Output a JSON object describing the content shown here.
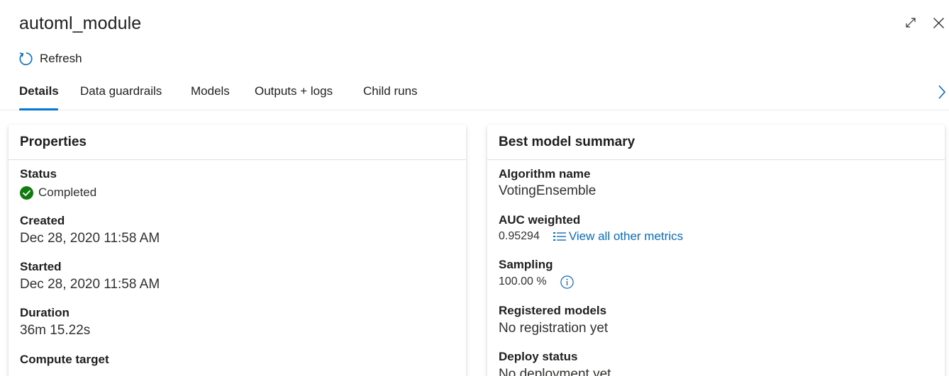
{
  "header": {
    "title": "automl_module",
    "refresh_label": "Refresh",
    "icons": {
      "expand": "expand-icon",
      "close": "close-icon",
      "refresh": "refresh-icon"
    }
  },
  "tabs": [
    {
      "label": "Details",
      "active": true
    },
    {
      "label": "Data guardrails",
      "active": false
    },
    {
      "label": "Models",
      "active": false
    },
    {
      "label": "Outputs + logs",
      "active": false
    },
    {
      "label": "Child runs",
      "active": false
    }
  ],
  "properties": {
    "heading": "Properties",
    "status_label": "Status",
    "status_value": "Completed",
    "created_label": "Created",
    "created_value": "Dec 28, 2020 11:58 AM",
    "started_label": "Started",
    "started_value": "Dec 28, 2020 11:58 AM",
    "duration_label": "Duration",
    "duration_value": "36m 15.22s",
    "compute_label": "Compute target"
  },
  "best_model": {
    "heading": "Best model summary",
    "algorithm_label": "Algorithm name",
    "algorithm_value": "VotingEnsemble",
    "auc_label": "AUC weighted",
    "auc_value": "0.95294",
    "view_metrics_label": "View all other metrics",
    "sampling_label": "Sampling",
    "sampling_value": "100.00 %",
    "registered_label": "Registered models",
    "registered_value": "No registration yet",
    "deploy_label": "Deploy status",
    "deploy_value": "No deployment yet"
  },
  "colors": {
    "accent": "#0078d4",
    "link": "#0f6cbd",
    "success": "#107c10",
    "text": "#201f1e"
  }
}
